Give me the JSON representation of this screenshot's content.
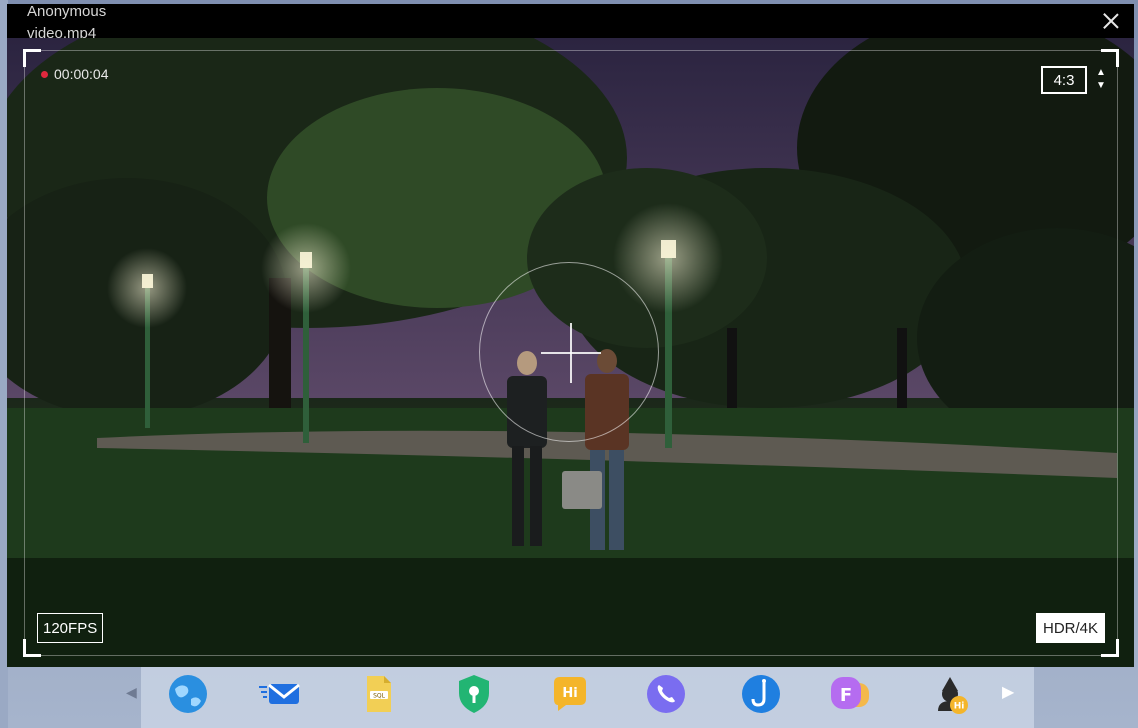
{
  "window": {
    "title_line1": "Anonymous",
    "title_line2": "video.mp4"
  },
  "viewfinder": {
    "timecode": "00:00:04",
    "aspect_ratio": "4:3",
    "ratio_up": "▲",
    "ratio_down": "▼",
    "fps": "120FPS",
    "quality": "HDR/4K"
  },
  "dock": {
    "next_arrow": "▶",
    "prev_arrow": "◀",
    "icons": [
      "globe-browser-icon",
      "mail-icon",
      "sql-file-icon",
      "security-shield-icon",
      "hi-chat-icon",
      "phone-call-icon",
      "fishing-hook-icon",
      "f-app-icon",
      "hacker-hi-icon"
    ]
  },
  "colors": {
    "record_dot": "#e0283e",
    "window_bg": "#000000",
    "dock_bg": "#c8d2e4"
  }
}
